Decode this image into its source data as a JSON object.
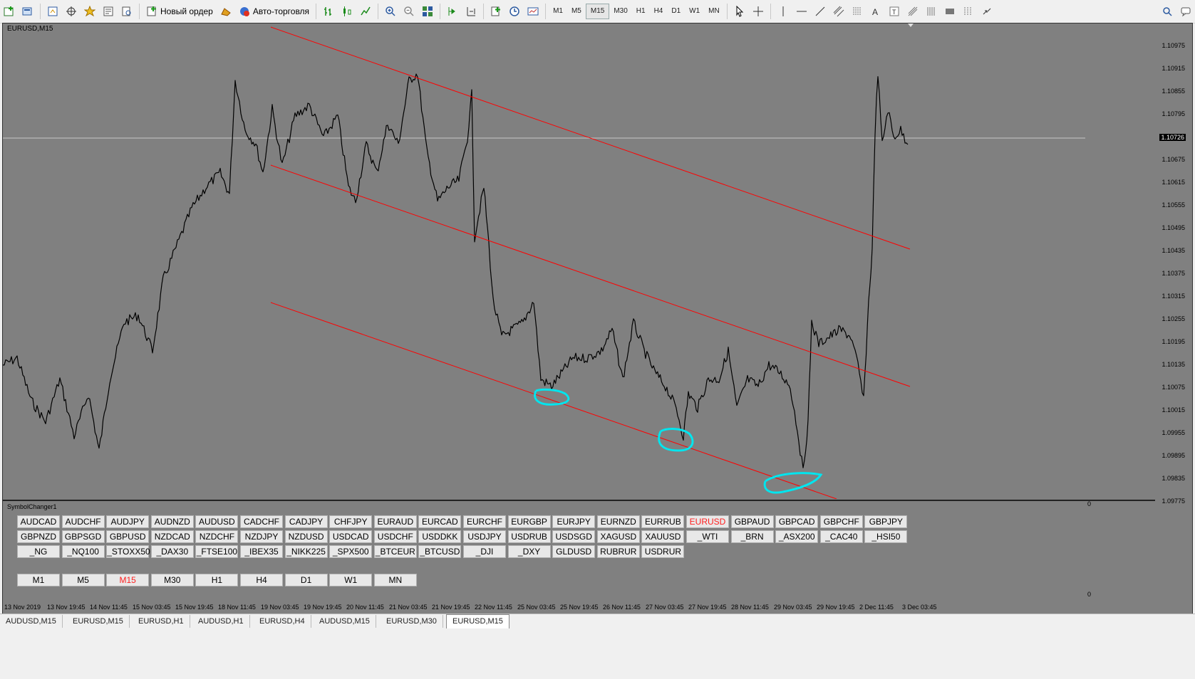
{
  "toolbar": {
    "new_order_label": "Новый ордер",
    "auto_trading_label": "Авто-торговля",
    "timeframes": [
      "M1",
      "M5",
      "M15",
      "M30",
      "H1",
      "H4",
      "D1",
      "W1",
      "MN"
    ],
    "active_timeframe": "M15"
  },
  "chart": {
    "title": "EURUSD,M15",
    "current_price": "1.10726",
    "price_labels": [
      "1.10975",
      "1.10915",
      "1.10855",
      "1.10795",
      "1.10735",
      "1.10675",
      "1.10615",
      "1.10555",
      "1.10495",
      "1.10435",
      "1.10375",
      "1.10315",
      "1.10255",
      "1.10195",
      "1.10135",
      "1.10075",
      "1.10015",
      "1.09955",
      "1.09895",
      "1.09835",
      "1.09775"
    ],
    "time_labels": [
      "13 Nov 2019",
      "13 Nov 19:45",
      "14 Nov 11:45",
      "15 Nov 03:45",
      "15 Nov 19:45",
      "18 Nov 11:45",
      "19 Nov 03:45",
      "19 Nov 19:45",
      "20 Nov 11:45",
      "21 Nov 03:45",
      "21 Nov 19:45",
      "22 Nov 11:45",
      "25 Nov 03:45",
      "25 Nov 19:45",
      "26 Nov 11:45",
      "27 Nov 03:45",
      "27 Nov 19:45",
      "28 Nov 11:45",
      "29 Nov 03:45",
      "29 Nov 19:45",
      "2 Dec 11:45",
      "3 Dec 03:45"
    ],
    "colors": {
      "background": "#808080",
      "price_line": "#000000",
      "channel": "#ff0000",
      "markup": "#00e5ee"
    }
  },
  "symbol_changer": {
    "title": "SymbolChanger1",
    "subwindow_scale_top": "0",
    "subwindow_scale_bottom": "0",
    "symbols_row1": [
      "AUDCAD",
      "AUDCHF",
      "AUDJPY",
      "AUDNZD",
      "AUDUSD",
      "CADCHF",
      "CADJPY",
      "CHFJPY",
      "EURAUD",
      "EURCAD",
      "EURCHF",
      "EURGBP",
      "EURJPY",
      "EURNZD",
      "EURRUB",
      "EURUSD",
      "GBPAUD",
      "GBPCAD",
      "GBPCHF",
      "GBPJPY"
    ],
    "symbols_row2": [
      "GBPNZD",
      "GBPSGD",
      "GBPUSD",
      "NZDCAD",
      "NZDCHF",
      "NZDJPY",
      "NZDUSD",
      "USDCAD",
      "USDCHF",
      "USDDKK",
      "USDJPY",
      "USDRUB",
      "USDSGD",
      "XAGUSD",
      "XAUUSD",
      "_WTI",
      "_BRN",
      "_ASX200",
      "_CAC40",
      "_HSI50"
    ],
    "symbols_row3": [
      "_NG",
      "_NQ100",
      "_STOXX50",
      "_DAX30",
      "_FTSE100",
      "_IBEX35",
      "_NIKK225",
      "_SPX500",
      "_BTCEUR",
      "_BTCUSD",
      "_DJI",
      "_DXY",
      "GLDUSD",
      "RUBRUR",
      "USDRUR"
    ],
    "selected_symbol": "EURUSD",
    "timeframes": [
      "M1",
      "M5",
      "M15",
      "M30",
      "H1",
      "H4",
      "D1",
      "W1",
      "MN"
    ],
    "selected_timeframe": "M15"
  },
  "tabs": [
    "AUDUSD,M15",
    "EURUSD,M15",
    "EURUSD,H1",
    "AUDUSD,H1",
    "EURUSD,H4",
    "AUDUSD,M15",
    "EURUSD,M30",
    "EURUSD,M15"
  ],
  "active_tab_index": 7
}
